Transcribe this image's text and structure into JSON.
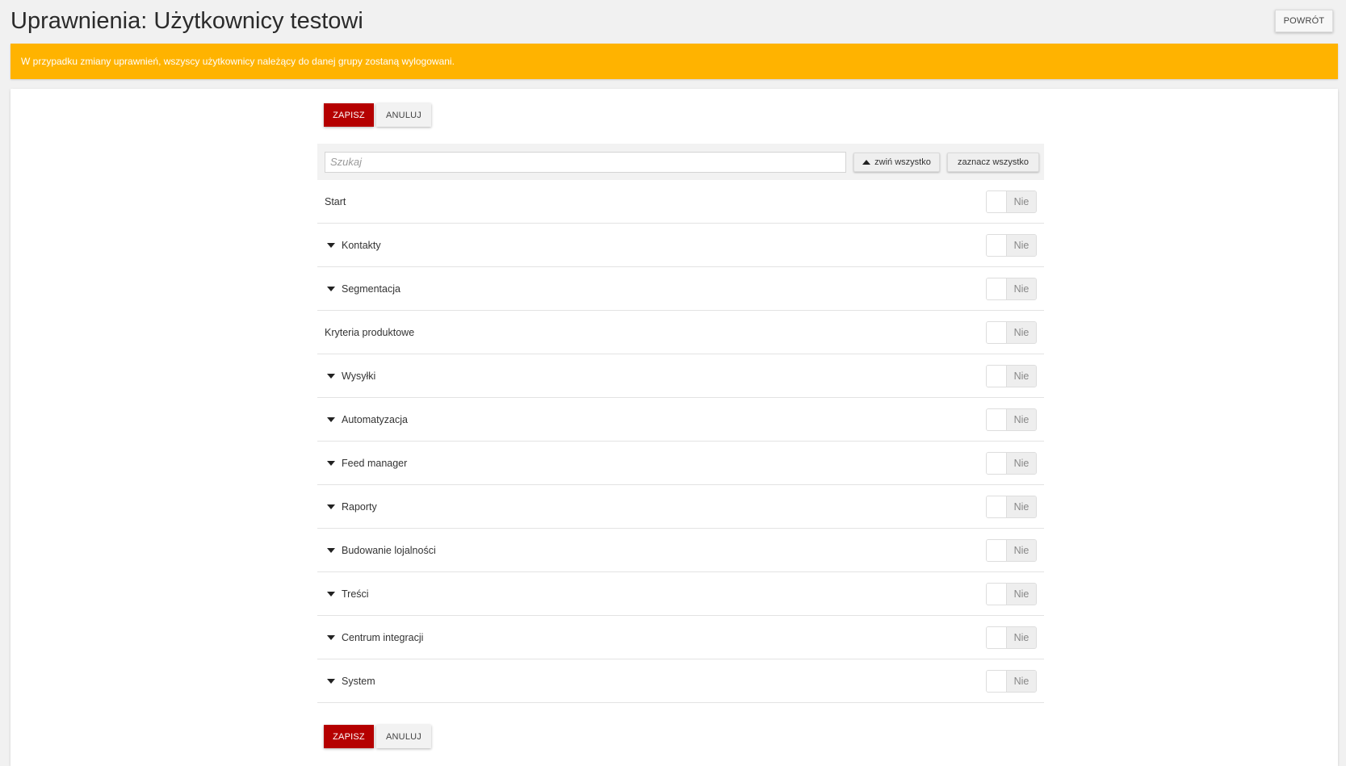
{
  "header": {
    "title": "Uprawnienia: Użytkownicy testowi",
    "back_label": "POWRÓT"
  },
  "alert": {
    "text": "W przypadku zmiany uprawnień, wszyscy użytkownicy należący do danej grupy zostaną wylogowani.",
    "color": "#ffb300"
  },
  "actions": {
    "save_label": "ZAPISZ",
    "cancel_label": "ANULUJ",
    "save_color": "#b50000"
  },
  "toolbar": {
    "search_placeholder": "Szukaj",
    "search_value": "",
    "collapse_all_label": "zwiń wszystko",
    "select_all_label": "zaznacz wszystko"
  },
  "permissions": [
    {
      "label": "Start",
      "expandable": false,
      "state": "Nie"
    },
    {
      "label": "Kontakty",
      "expandable": true,
      "state": "Nie"
    },
    {
      "label": "Segmentacja",
      "expandable": true,
      "state": "Nie"
    },
    {
      "label": "Kryteria produktowe",
      "expandable": false,
      "state": "Nie"
    },
    {
      "label": "Wysyłki",
      "expandable": true,
      "state": "Nie"
    },
    {
      "label": "Automatyzacja",
      "expandable": true,
      "state": "Nie"
    },
    {
      "label": "Feed manager",
      "expandable": true,
      "state": "Nie"
    },
    {
      "label": "Raporty",
      "expandable": true,
      "state": "Nie"
    },
    {
      "label": "Budowanie lojalności",
      "expandable": true,
      "state": "Nie"
    },
    {
      "label": "Treści",
      "expandable": true,
      "state": "Nie"
    },
    {
      "label": "Centrum integracji",
      "expandable": true,
      "state": "Nie"
    },
    {
      "label": "System",
      "expandable": true,
      "state": "Nie"
    }
  ]
}
